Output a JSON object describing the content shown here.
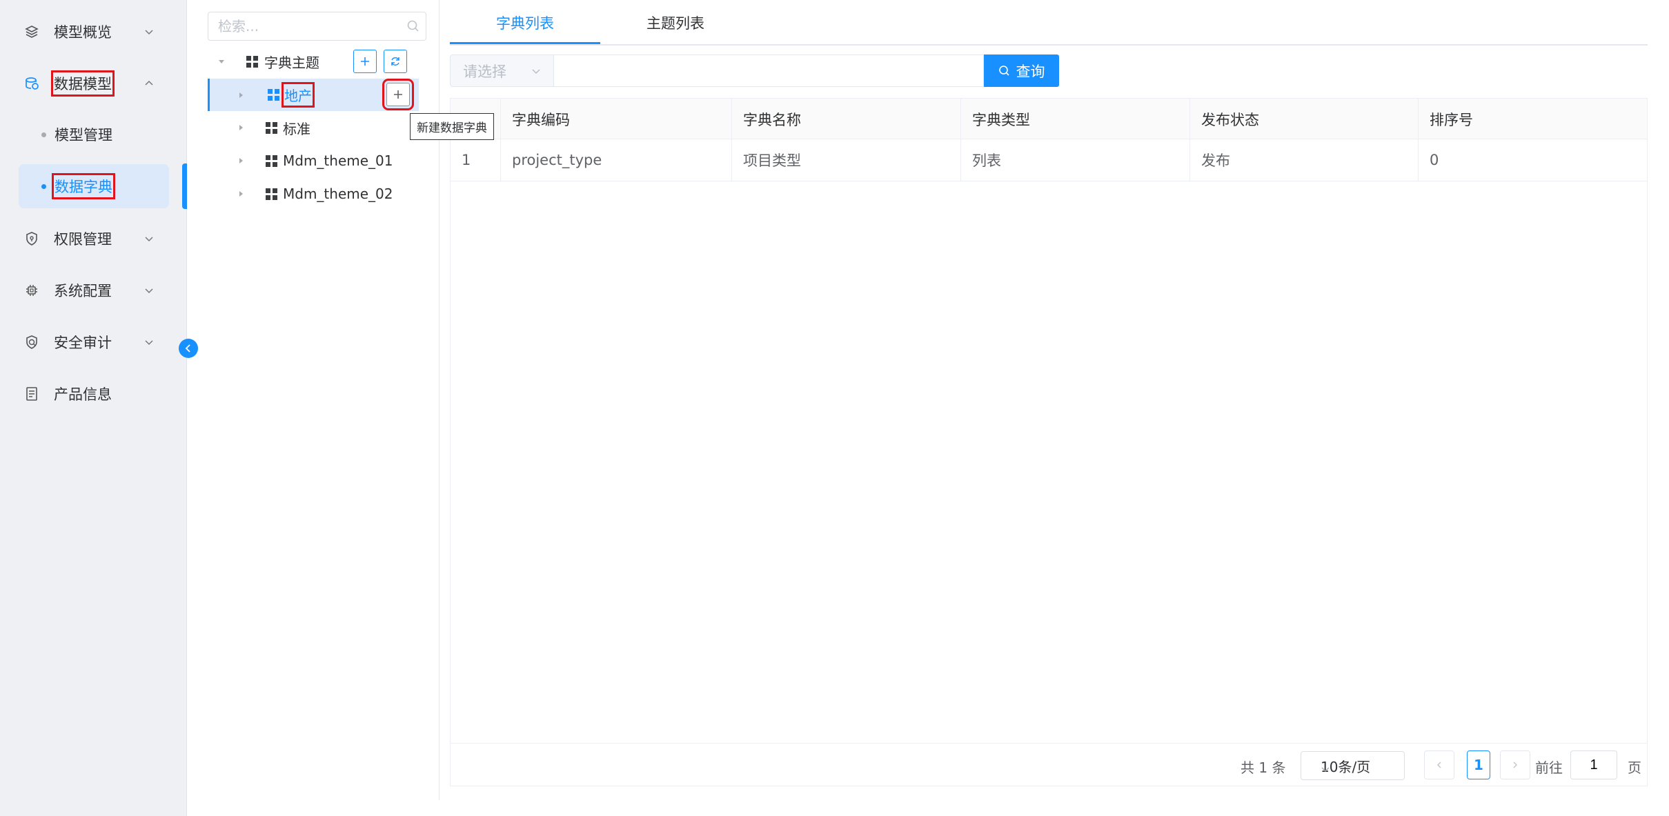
{
  "sidebar": {
    "items": [
      {
        "label": "模型概览",
        "icon": "layers-icon"
      },
      {
        "label": "数据模型",
        "icon": "database-icon"
      },
      {
        "label": "权限管理",
        "icon": "shield-icon"
      },
      {
        "label": "系统配置",
        "icon": "chip-icon"
      },
      {
        "label": "安全审计",
        "icon": "security-shield-icon"
      },
      {
        "label": "产品信息",
        "icon": "document-icon"
      }
    ],
    "sub_items": [
      {
        "label": "模型管理"
      },
      {
        "label": "数据字典"
      }
    ]
  },
  "tree": {
    "search_placeholder": "检索...",
    "root_label": "字典主题",
    "nodes": [
      {
        "label": "地产"
      },
      {
        "label": "标准"
      },
      {
        "label": "Mdm_theme_01"
      },
      {
        "label": "Mdm_theme_02"
      }
    ],
    "tooltip": "新建数据字典"
  },
  "tabs": [
    {
      "label": "字典列表"
    },
    {
      "label": "主题列表"
    }
  ],
  "filter": {
    "select_placeholder": "请选择",
    "input_value": "",
    "query_label": "查询"
  },
  "table": {
    "columns": [
      "",
      "字典编码",
      "字典名称",
      "字典类型",
      "发布状态",
      "排序号"
    ],
    "rows": [
      [
        "1",
        "project_type",
        "项目类型",
        "列表",
        "发布",
        "0"
      ]
    ]
  },
  "pagination": {
    "total_text": "共 1 条",
    "page_size": "10条/页",
    "current_page": "1",
    "goto_label": "前往",
    "goto_value": "1",
    "page_unit": "页"
  },
  "colors": {
    "accent": "#1890ff",
    "highlight_box": "#e0151b",
    "sidebar_bg": "#eef0f3"
  }
}
